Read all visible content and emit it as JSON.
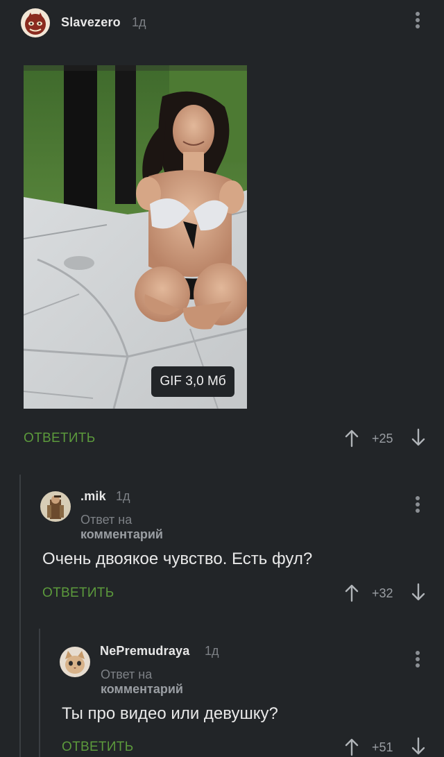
{
  "comments": [
    {
      "username": "Slavezero",
      "time": "1д",
      "gif_label": "GIF 3,0 Мб",
      "reply_label": "ОТВЕТИТЬ",
      "score": "+25"
    },
    {
      "username": ".mik",
      "time": "1д",
      "reply_to_prefix": "Ответ на",
      "reply_to_target": "комментарий",
      "text": "Очень двоякое чувство. Есть фул?",
      "reply_label": "ОТВЕТИТЬ",
      "score": "+32"
    },
    {
      "username": "NePremudraya",
      "time": "1д",
      "reply_to_prefix": "Ответ на",
      "reply_to_target": "комментарий",
      "text": "Ты про видео или девушку?",
      "reply_label": "ОТВЕТИТЬ",
      "score": "+51"
    }
  ],
  "colors": {
    "background": "#222528",
    "reply_green": "#5c9a3c",
    "muted_text": "#7d8186",
    "thread_line": "#3a3e42"
  },
  "icons": [
    "avatar",
    "kebab-menu-icon",
    "arrow-up-icon",
    "arrow-down-icon"
  ]
}
